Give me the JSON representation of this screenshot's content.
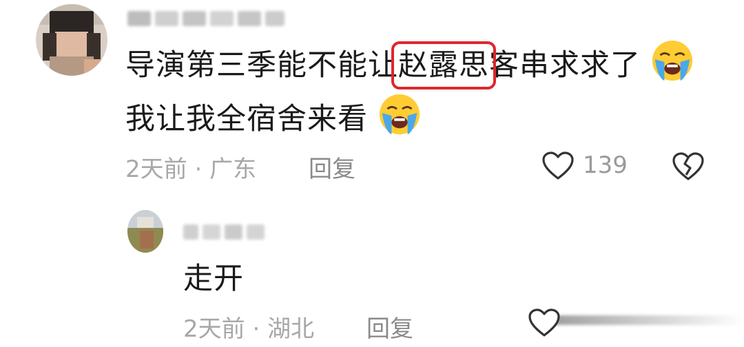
{
  "comment": {
    "line1_before": "导演第三季能不能让",
    "line1_highlight": "赵露思",
    "line1_after": "客串求求了",
    "line2": "我让我全宿舍来看",
    "time": "2天前",
    "separator": "·",
    "location": "广东",
    "reply_label": "回复",
    "like_count": "139"
  },
  "reply": {
    "text": "走开",
    "time": "2天前",
    "separator": "·",
    "location": "湖北",
    "reply_label": "回复"
  },
  "icons": {
    "emoji": "loudly-crying-face-icon",
    "like": "heart-outline-icon",
    "dislike": "broken-heart-icon"
  },
  "colors": {
    "highlight_box": "#e0262b",
    "meta_text": "#a8a8a8"
  }
}
